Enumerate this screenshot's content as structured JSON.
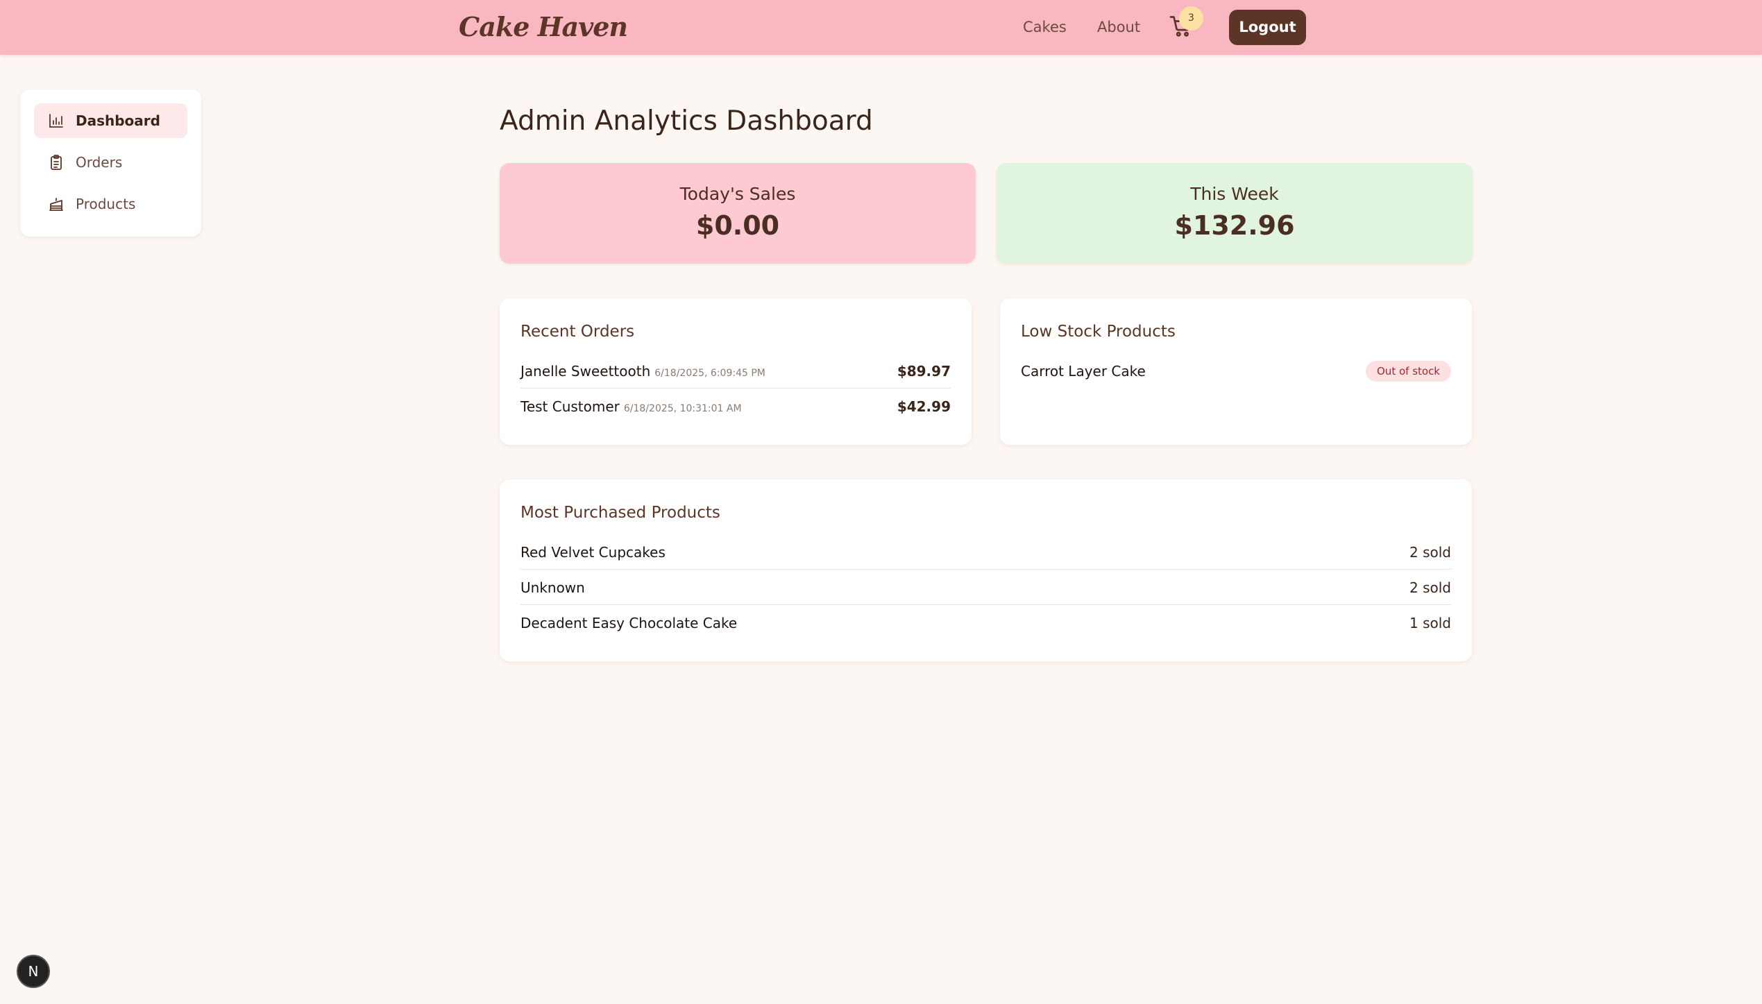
{
  "header": {
    "logo": "Cake Haven",
    "nav": {
      "cakes": "Cakes",
      "about": "About"
    },
    "cart": {
      "icon": "cart-icon",
      "count": "3"
    },
    "logout_label": "Logout"
  },
  "sidebar": {
    "items": [
      {
        "label": "Dashboard",
        "icon": "bar-chart-icon",
        "active": true
      },
      {
        "label": "Orders",
        "icon": "clipboard-icon",
        "active": false
      },
      {
        "label": "Products",
        "icon": "cake-icon",
        "active": false
      }
    ]
  },
  "main": {
    "title": "Admin Analytics Dashboard",
    "stats": {
      "today": {
        "label": "Today's Sales",
        "value": "$0.00"
      },
      "week": {
        "label": "This Week",
        "value": "$132.96"
      }
    },
    "recent_orders": {
      "title": "Recent Orders",
      "rows": [
        {
          "customer": "Janelle Sweettooth",
          "time": "6/18/2025, 6:09:45 PM",
          "amount": "$89.97"
        },
        {
          "customer": "Test Customer",
          "time": "6/18/2025, 10:31:01 AM",
          "amount": "$42.99"
        }
      ]
    },
    "low_stock": {
      "title": "Low Stock Products",
      "rows": [
        {
          "name": "Carrot Layer Cake",
          "status": "Out of stock"
        }
      ]
    },
    "most_purchased": {
      "title": "Most Purchased Products",
      "rows": [
        {
          "name": "Red Velvet Cupcakes",
          "sold": "2 sold"
        },
        {
          "name": "Unknown",
          "sold": "2 sold"
        },
        {
          "name": "Decadent Easy Chocolate Cake",
          "sold": "1 sold"
        }
      ]
    }
  },
  "dev_badge": "N",
  "colors": {
    "header_bg": "#f9b7c2",
    "brand_brown": "#5c3526",
    "page_bg": "#fdf7f3",
    "today_card": "#fdcad2",
    "week_card": "#e1f4e0",
    "stock_badge_bg": "#fde0e2",
    "stock_badge_text": "#a0282c"
  }
}
